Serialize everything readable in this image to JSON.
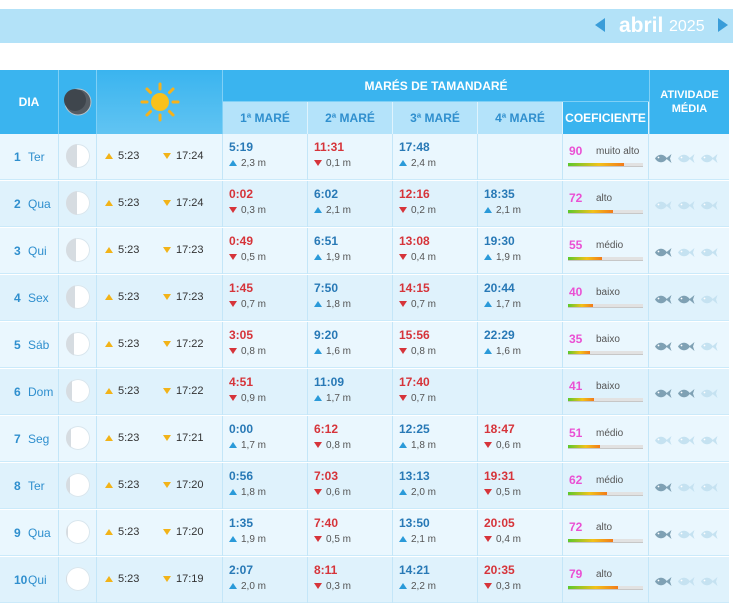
{
  "month": {
    "name": "abril",
    "year": "2025"
  },
  "header": {
    "day": "DIA",
    "tides_title": "MARÉS DE TAMANDARÉ",
    "tide_cols": [
      "1ª MARÉ",
      "2ª MARÉ",
      "3ª MARÉ",
      "4ª MARÉ"
    ],
    "coef": "COEFICIENTE",
    "activity": "ATIVIDADE MÉDIA"
  },
  "colors": {
    "high_tide": "#2879b6",
    "low_tide": "#d6343a",
    "coef": "#ea50d3",
    "header": "#3ab4ef"
  },
  "rows": [
    {
      "day": "1",
      "dow": "Ter",
      "rise": "5:23",
      "set": "17:24",
      "moon": 0.05,
      "tides": [
        {
          "t": "5:19",
          "h": "2,3 m",
          "type": "hi"
        },
        {
          "t": "11:31",
          "h": "0,1 m",
          "type": "lo"
        },
        {
          "t": "17:48",
          "h": "2,4 m",
          "type": "hi"
        },
        null
      ],
      "coef": "90",
      "coef_label": "muito alto",
      "coef_level": 0.75,
      "fish": [
        2,
        1,
        1
      ]
    },
    {
      "day": "2",
      "dow": "Qua",
      "rise": "5:23",
      "set": "17:24",
      "moon": 0.1,
      "tides": [
        {
          "t": "0:02",
          "h": "0,3 m",
          "type": "lo"
        },
        {
          "t": "6:02",
          "h": "2,1 m",
          "type": "hi"
        },
        {
          "t": "12:16",
          "h": "0,2 m",
          "type": "lo"
        },
        {
          "t": "18:35",
          "h": "2,1 m",
          "type": "hi"
        }
      ],
      "coef": "72",
      "coef_label": "alto",
      "coef_level": 0.6,
      "fish": [
        1,
        1,
        1
      ]
    },
    {
      "day": "3",
      "dow": "Qui",
      "rise": "5:23",
      "set": "17:23",
      "moon": 0.18,
      "tides": [
        {
          "t": "0:49",
          "h": "0,5 m",
          "type": "lo"
        },
        {
          "t": "6:51",
          "h": "1,9 m",
          "type": "hi"
        },
        {
          "t": "13:08",
          "h": "0,4 m",
          "type": "lo"
        },
        {
          "t": "19:30",
          "h": "1,9 m",
          "type": "hi"
        }
      ],
      "coef": "55",
      "coef_label": "médio",
      "coef_level": 0.45,
      "fish": [
        2,
        1,
        1
      ]
    },
    {
      "day": "4",
      "dow": "Sex",
      "rise": "5:23",
      "set": "17:23",
      "moon": 0.27,
      "tides": [
        {
          "t": "1:45",
          "h": "0,7 m",
          "type": "lo"
        },
        {
          "t": "7:50",
          "h": "1,8 m",
          "type": "hi"
        },
        {
          "t": "14:15",
          "h": "0,7 m",
          "type": "lo"
        },
        {
          "t": "20:44",
          "h": "1,7 m",
          "type": "hi"
        }
      ],
      "coef": "40",
      "coef_label": "baixo",
      "coef_level": 0.33,
      "fish": [
        2,
        2,
        1
      ]
    },
    {
      "day": "5",
      "dow": "Sáb",
      "rise": "5:23",
      "set": "17:22",
      "moon": 0.37,
      "tides": [
        {
          "t": "3:05",
          "h": "0,8 m",
          "type": "lo"
        },
        {
          "t": "9:20",
          "h": "1,6 m",
          "type": "hi"
        },
        {
          "t": "15:56",
          "h": "0,8 m",
          "type": "lo"
        },
        {
          "t": "22:29",
          "h": "1,6 m",
          "type": "hi"
        }
      ],
      "coef": "35",
      "coef_label": "baixo",
      "coef_level": 0.29,
      "fish": [
        2,
        2,
        1
      ]
    },
    {
      "day": "6",
      "dow": "Dom",
      "rise": "5:23",
      "set": "17:22",
      "moon": 0.46,
      "tides": [
        {
          "t": "4:51",
          "h": "0,9 m",
          "type": "lo"
        },
        {
          "t": "11:09",
          "h": "1,7 m",
          "type": "hi"
        },
        {
          "t": "17:40",
          "h": "0,7 m",
          "type": "lo"
        },
        null
      ],
      "coef": "41",
      "coef_label": "baixo",
      "coef_level": 0.34,
      "fish": [
        2,
        2,
        1
      ]
    },
    {
      "day": "7",
      "dow": "Seg",
      "rise": "5:23",
      "set": "17:21",
      "moon": 0.58,
      "tides": [
        {
          "t": "0:00",
          "h": "1,7 m",
          "type": "hi"
        },
        {
          "t": "6:12",
          "h": "0,8 m",
          "type": "lo"
        },
        {
          "t": "12:25",
          "h": "1,8 m",
          "type": "hi"
        },
        {
          "t": "18:47",
          "h": "0,6 m",
          "type": "lo"
        }
      ],
      "coef": "51",
      "coef_label": "médio",
      "coef_level": 0.42,
      "fish": [
        1,
        1,
        1
      ]
    },
    {
      "day": "8",
      "dow": "Ter",
      "rise": "5:23",
      "set": "17:20",
      "moon": 0.7,
      "tides": [
        {
          "t": "0:56",
          "h": "1,8 m",
          "type": "hi"
        },
        {
          "t": "7:03",
          "h": "0,6 m",
          "type": "lo"
        },
        {
          "t": "13:13",
          "h": "2,0 m",
          "type": "hi"
        },
        {
          "t": "19:31",
          "h": "0,5 m",
          "type": "lo"
        }
      ],
      "coef": "62",
      "coef_label": "médio",
      "coef_level": 0.52,
      "fish": [
        2,
        1,
        1
      ]
    },
    {
      "day": "9",
      "dow": "Qua",
      "rise": "5:23",
      "set": "17:20",
      "moon": 0.82,
      "tides": [
        {
          "t": "1:35",
          "h": "1,9 m",
          "type": "hi"
        },
        {
          "t": "7:40",
          "h": "0,5 m",
          "type": "lo"
        },
        {
          "t": "13:50",
          "h": "2,1 m",
          "type": "hi"
        },
        {
          "t": "20:05",
          "h": "0,4 m",
          "type": "lo"
        }
      ],
      "coef": "72",
      "coef_label": "alto",
      "coef_level": 0.6,
      "fish": [
        2,
        1,
        1
      ]
    },
    {
      "day": "10",
      "dow": "Qui",
      "rise": "5:23",
      "set": "17:19",
      "moon": 0.92,
      "tides": [
        {
          "t": "2:07",
          "h": "2,0 m",
          "type": "hi"
        },
        {
          "t": "8:11",
          "h": "0,3 m",
          "type": "lo"
        },
        {
          "t": "14:21",
          "h": "2,2 m",
          "type": "hi"
        },
        {
          "t": "20:35",
          "h": "0,3 m",
          "type": "lo"
        }
      ],
      "coef": "79",
      "coef_label": "alto",
      "coef_level": 0.66,
      "fish": [
        2,
        1,
        1
      ]
    }
  ]
}
